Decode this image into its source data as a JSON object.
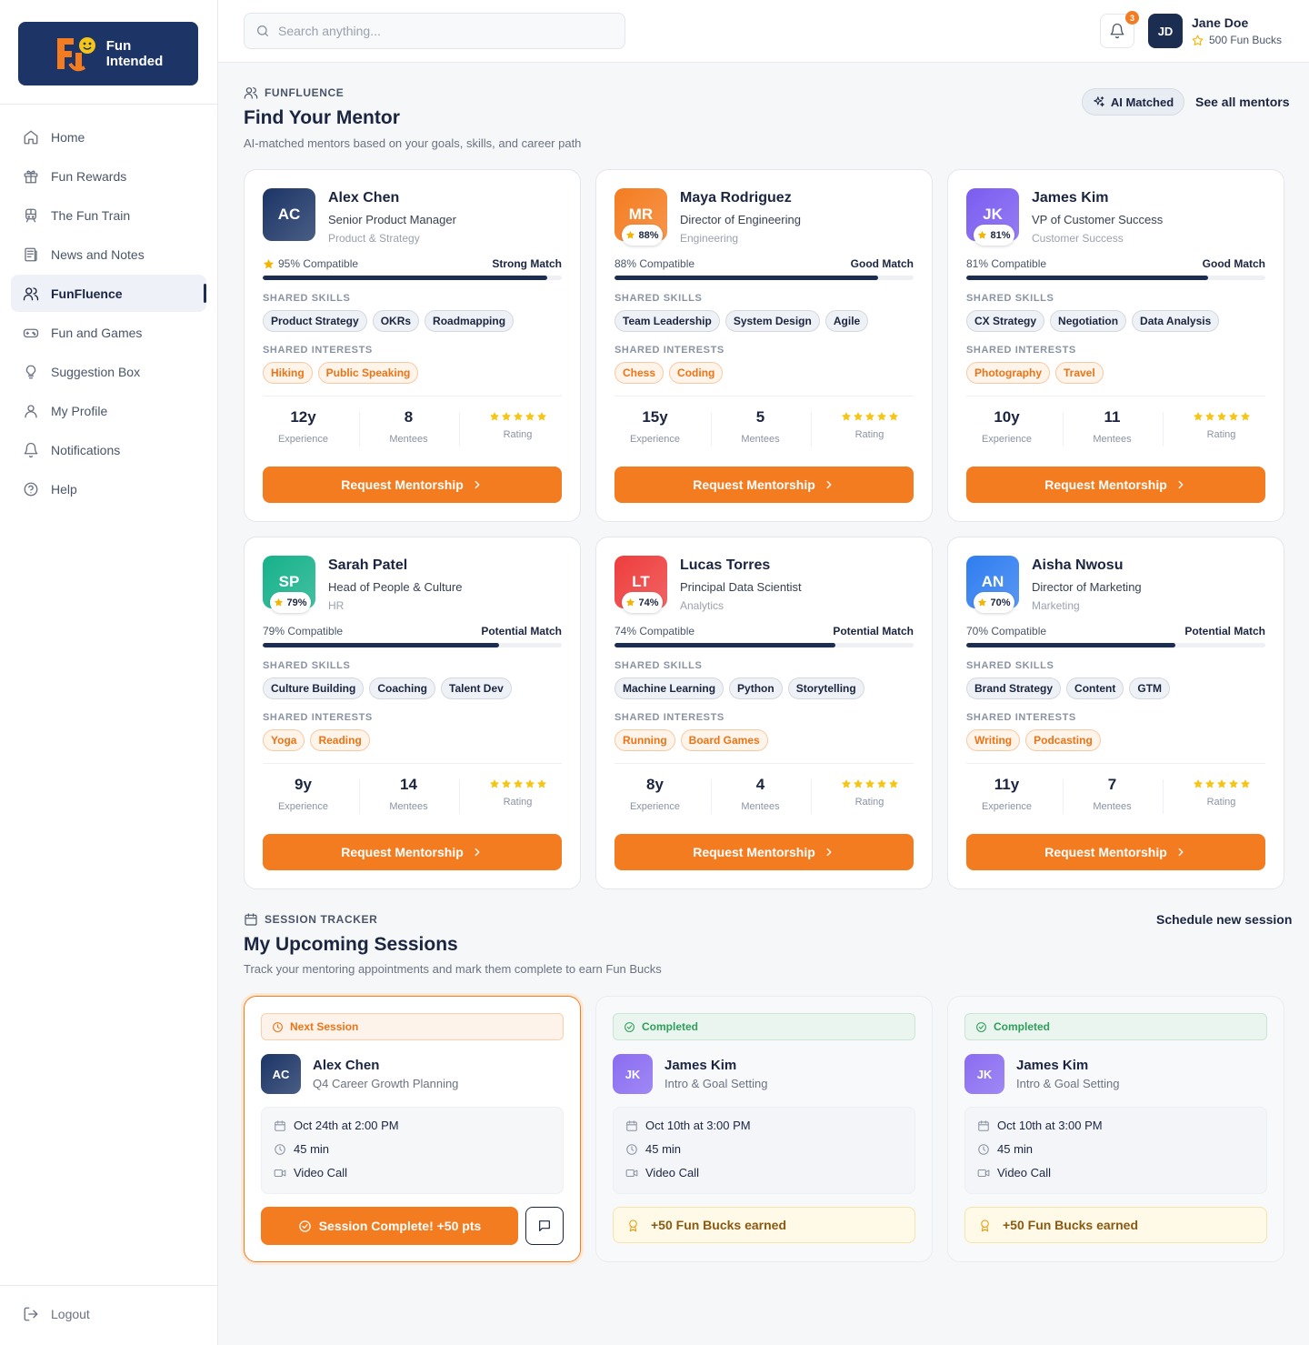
{
  "brand": {
    "line1": "Fun",
    "line2": "Intended"
  },
  "sidebar": {
    "items": [
      {
        "label": "Home",
        "icon": "home-icon"
      },
      {
        "label": "Fun Rewards",
        "icon": "gift-icon"
      },
      {
        "label": "The Fun Train",
        "icon": "train-icon"
      },
      {
        "label": "News and Notes",
        "icon": "newspaper-icon"
      },
      {
        "label": "FunFluence",
        "icon": "users-icon"
      },
      {
        "label": "Fun and Games",
        "icon": "gamepad-icon"
      },
      {
        "label": "Suggestion Box",
        "icon": "lightbulb-icon"
      },
      {
        "label": "My Profile",
        "icon": "user-icon"
      },
      {
        "label": "Notifications",
        "icon": "bell-icon"
      },
      {
        "label": "Help",
        "icon": "help-circle-icon"
      }
    ],
    "active_index": 4,
    "logout": "Logout"
  },
  "header": {
    "search_placeholder": "Search anything...",
    "notification_count": "3",
    "user": {
      "initials": "JD",
      "name": "Jane Doe",
      "bucks": "500 Fun Bucks"
    }
  },
  "mentors_section": {
    "eyebrow": "FUNFLUENCE",
    "title": "Find Your Mentor",
    "subtitle": "AI-matched mentors based on your goals, skills, and career path",
    "ai_badge": "AI Matched",
    "see_all": "See all mentors",
    "skills_label": "SHARED SKILLS",
    "interests_label": "SHARED INTERESTS",
    "experience_label": "Experience",
    "mentees_label": "Mentees",
    "rating_label": "Rating",
    "request_label": "Request Mentorship",
    "mentors": [
      {
        "initials": "AC",
        "name": "Alex Chen",
        "role": "Senior Product Manager",
        "dept": "Product & Strategy",
        "compat_text": "95% Compatible",
        "compat": 0.95,
        "badge": "",
        "match": "Strong Match",
        "skills": [
          "Product Strategy",
          "OKRs",
          "Roadmapping"
        ],
        "interests": [
          "Hiking",
          "Public Speaking"
        ],
        "experience": "12y",
        "mentees": "8",
        "rating": 5,
        "color": "#1c3566"
      },
      {
        "initials": "MR",
        "name": "Maya Rodriguez",
        "role": "Director of Engineering",
        "dept": "Engineering",
        "compat_text": "88% Compatible",
        "compat": 0.88,
        "badge": "88%",
        "match": "Good Match",
        "skills": [
          "Team Leadership",
          "System Design",
          "Agile"
        ],
        "interests": [
          "Chess",
          "Coding"
        ],
        "experience": "15y",
        "mentees": "5",
        "rating": 5,
        "color": "#f47c20"
      },
      {
        "initials": "JK",
        "name": "James Kim",
        "role": "VP of Customer Success",
        "dept": "Customer Success",
        "compat_text": "81% Compatible",
        "compat": 0.81,
        "badge": "81%",
        "match": "Good Match",
        "skills": [
          "CX Strategy",
          "Negotiation",
          "Data Analysis"
        ],
        "interests": [
          "Photography",
          "Travel"
        ],
        "experience": "10y",
        "mentees": "11",
        "rating": 5,
        "color": "#7b5cf0"
      },
      {
        "initials": "SP",
        "name": "Sarah Patel",
        "role": "Head of People & Culture",
        "dept": "HR",
        "compat_text": "79% Compatible",
        "compat": 0.79,
        "badge": "79%",
        "match": "Potential Match",
        "skills": [
          "Culture Building",
          "Coaching",
          "Talent Dev"
        ],
        "interests": [
          "Yoga",
          "Reading"
        ],
        "experience": "9y",
        "mentees": "14",
        "rating": 5,
        "color": "#15b18a"
      },
      {
        "initials": "LT",
        "name": "Lucas Torres",
        "role": "Principal Data Scientist",
        "dept": "Analytics",
        "compat_text": "74% Compatible",
        "compat": 0.74,
        "badge": "74%",
        "match": "Potential Match",
        "skills": [
          "Machine Learning",
          "Python",
          "Storytelling"
        ],
        "interests": [
          "Running",
          "Board Games"
        ],
        "experience": "8y",
        "mentees": "4",
        "rating": 5,
        "color": "#ee3d3d"
      },
      {
        "initials": "AN",
        "name": "Aisha Nwosu",
        "role": "Director of Marketing",
        "dept": "Marketing",
        "compat_text": "70% Compatible",
        "compat": 0.7,
        "badge": "70%",
        "match": "Potential Match",
        "skills": [
          "Brand Strategy",
          "Content",
          "GTM"
        ],
        "interests": [
          "Writing",
          "Podcasting"
        ],
        "experience": "11y",
        "mentees": "7",
        "rating": 5,
        "color": "#2f7df0"
      }
    ]
  },
  "sessions_section": {
    "eyebrow": "SESSION TRACKER",
    "title": "My Upcoming Sessions",
    "subtitle": "Track your mentoring appointments and mark them complete to earn Fun Bucks",
    "schedule": "Schedule new session",
    "sessions": [
      {
        "status": "Next Session",
        "initials": "AC",
        "name": "Alex Chen",
        "topic": "Q4 Career Growth Planning",
        "date": "Oct 24th at 2:00 PM",
        "duration": "45 min",
        "mode": "Video Call",
        "action": "Session Complete! +50 pts",
        "color": "#1c3566"
      },
      {
        "status": "Completed",
        "initials": "JK",
        "name": "James Kim",
        "topic": "Intro & Goal Setting",
        "date": "Oct 10th at 3:00 PM",
        "duration": "45 min",
        "mode": "Video Call",
        "earned": "+50 Fun Bucks earned",
        "color": "#8a6cf2"
      },
      {
        "status": "Completed",
        "initials": "JK",
        "name": "James Kim",
        "topic": "Intro & Goal Setting",
        "date": "Oct 10th at 3:00 PM",
        "duration": "45 min",
        "mode": "Video Call",
        "earned": "+50 Fun Bucks earned",
        "color": "#8a6cf2"
      }
    ]
  },
  "colors": {
    "accent": "#f47c20",
    "navy": "#1c2d52",
    "gold": "#f5c518"
  }
}
